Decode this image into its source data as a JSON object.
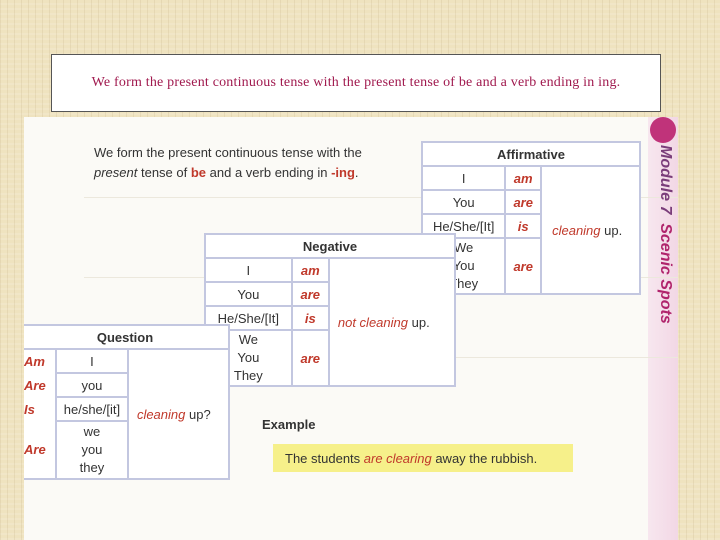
{
  "slide_title": "We form the present continuous tense with the present tense of be and a verb ending in ing.",
  "intro": {
    "line1": "We form the present continuous tense with the",
    "present": "present",
    "tense_of": " tense of ",
    "be": "be",
    "and_verb": " and a verb ending in ",
    "ing": "-ing",
    "period": "."
  },
  "affirmative": {
    "header": "Affirmative",
    "rows": [
      {
        "subject": "I",
        "aux": "am"
      },
      {
        "subject": "You",
        "aux": "are"
      },
      {
        "subject": "He/She/[It]",
        "aux": "is"
      },
      {
        "subject": "We\nYou\nThey",
        "aux": "are"
      }
    ],
    "verb": "cleaning",
    "particle": "up."
  },
  "negative": {
    "header": "Negative",
    "rows": [
      {
        "subject": "I",
        "aux": "am"
      },
      {
        "subject": "You",
        "aux": "are"
      },
      {
        "subject": "He/She/[It]",
        "aux": "is"
      },
      {
        "subject": "We\nYou\nThey",
        "aux": "are"
      }
    ],
    "verb": "not cleaning",
    "particle": "up."
  },
  "question": {
    "header": "Question",
    "rows": [
      {
        "aux": "Am",
        "subject": "I"
      },
      {
        "aux": "Are",
        "subject": "you"
      },
      {
        "aux": "Is",
        "subject": "he/she/[it]"
      },
      {
        "aux": "Are",
        "subject": "we\nyou\nthey"
      }
    ],
    "verb": "cleaning",
    "particle": "up?"
  },
  "example": {
    "label": "Example",
    "sentence_start": "The students ",
    "verb": "are clearing",
    "sentence_end": " away the rubbish."
  },
  "side_label": {
    "module": "Module 7",
    "topic": "Scenic Spots"
  }
}
